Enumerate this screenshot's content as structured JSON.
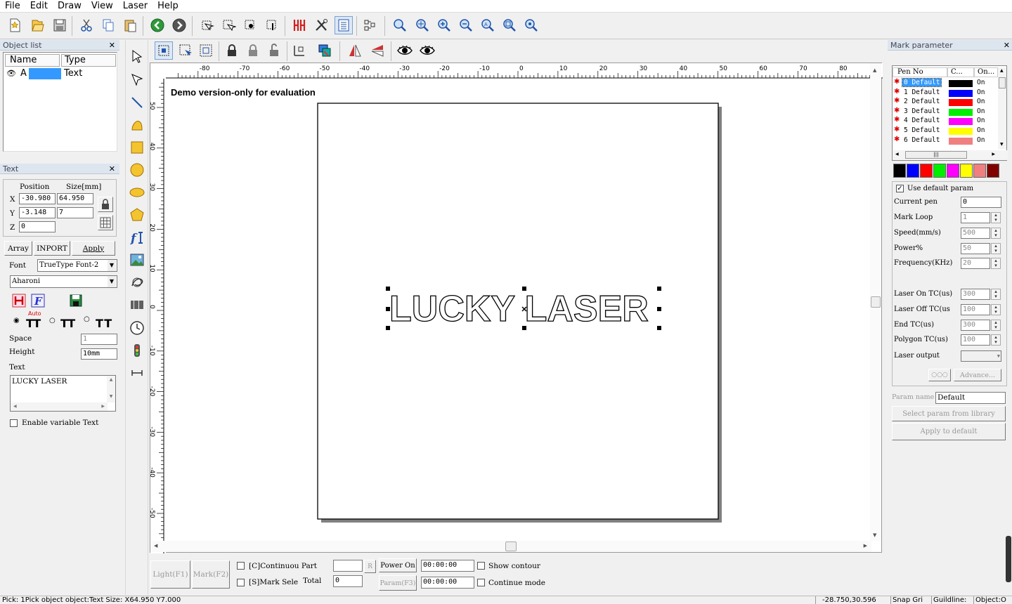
{
  "menu": [
    "File",
    "Edit",
    "Draw",
    "View",
    "Laser",
    "Help"
  ],
  "object_list": {
    "title": "Object list",
    "col_name": "Name",
    "col_type": "Type",
    "row": {
      "name": "A",
      "type": "Text"
    }
  },
  "text_panel": {
    "title": "Text",
    "position_label": "Position",
    "size_label": "Size[mm]",
    "x_label": "X",
    "y_label": "Y",
    "z_label": "Z",
    "x_pos": "-30.980",
    "x_size": "64.950",
    "y_pos": "-3.148",
    "y_size": "7",
    "z_pos": "0",
    "array_btn": "Array",
    "import_btn": "INPORT",
    "apply_btn": "Apply",
    "font_label": "Font",
    "font_type": "TrueType Font-2",
    "font_name": "Aharoni",
    "auto_label": "Auto",
    "space_label": "Space",
    "space_value": "1",
    "height_label": "Height",
    "height_value": "10mm",
    "text_label": "Text",
    "text_value": "LUCKY LASER",
    "enable_variable": "Enable variable Text"
  },
  "canvas": {
    "demo_text": "Demo version-only for evaluation",
    "object_text": "LUCKY LASER",
    "h_ticks": [
      "-80",
      "-70",
      "-60",
      "-50",
      "-40",
      "-30",
      "-20",
      "-10",
      "0",
      "10",
      "20",
      "30",
      "40",
      "50",
      "60",
      "70",
      "80"
    ],
    "v_ticks": [
      "50",
      "40",
      "30",
      "20",
      "10",
      "0",
      "-10",
      "-20",
      "-30",
      "-40",
      "-50"
    ]
  },
  "bottom": {
    "light_btn": "Light(F1)",
    "mark_btn": "Mark(F2)",
    "continuous_part": "[C]Continuou Part",
    "mark_select": "[S]Mark Sele",
    "total_label": "Total",
    "total_value": "0",
    "r_btn": "R",
    "power_on": "Power On",
    "power_time": "00:00:00",
    "param_btn": "Param(F3)",
    "param_time": "00:00:00",
    "show_contour": "Show contour",
    "continue_mode": "Continue mode"
  },
  "status": {
    "text": "Pick: 1Pick object object:Text Size: X64.950 Y7.000",
    "coords": "-28.750,30.596",
    "snap": "Snap Gri",
    "guideline": "Guildline:",
    "object": "Object:O"
  },
  "mark_param": {
    "title": "Mark parameter",
    "col_pen": "Pen No",
    "col_color": "C...",
    "col_on": "On...",
    "pens": [
      {
        "label": "0 Default",
        "color": "#000000",
        "on": "On"
      },
      {
        "label": "1 Default",
        "color": "#0000ff",
        "on": "On"
      },
      {
        "label": "2 Default",
        "color": "#ff0000",
        "on": "On"
      },
      {
        "label": "3 Default",
        "color": "#00ee00",
        "on": "On"
      },
      {
        "label": "4 Default",
        "color": "#ff00ff",
        "on": "On"
      },
      {
        "label": "5 Default",
        "color": "#ffff00",
        "on": "On"
      },
      {
        "label": "6 Default",
        "color": "#f08080",
        "on": "On"
      }
    ],
    "palette": [
      "#000000",
      "#0000ff",
      "#ff0000",
      "#00ee00",
      "#ff00ff",
      "#ffff00",
      "#f08080",
      "#800000"
    ],
    "use_default": "Use default param",
    "current_pen_label": "Current pen",
    "current_pen": "0",
    "mark_loop_label": "Mark Loop",
    "mark_loop": "1",
    "speed_label": "Speed(mm/s)",
    "speed": "500",
    "power_label": "Power%",
    "power": "50",
    "freq_label": "Frequency(KHz)",
    "freq": "20",
    "laser_on_label": "Laser On TC(us)",
    "laser_on": "300",
    "laser_off_label": "Laser Off TC(us",
    "laser_off": "100",
    "end_tc_label": "End TC(us)",
    "end_tc": "300",
    "polygon_label": "Polygon TC(us)",
    "polygon": "100",
    "laser_output_label": "Laser output",
    "advance_btn": "Advance...",
    "param_name_label": "Param name",
    "param_name": "Default",
    "select_library": "Select param from library",
    "apply_default": "Apply to default"
  }
}
